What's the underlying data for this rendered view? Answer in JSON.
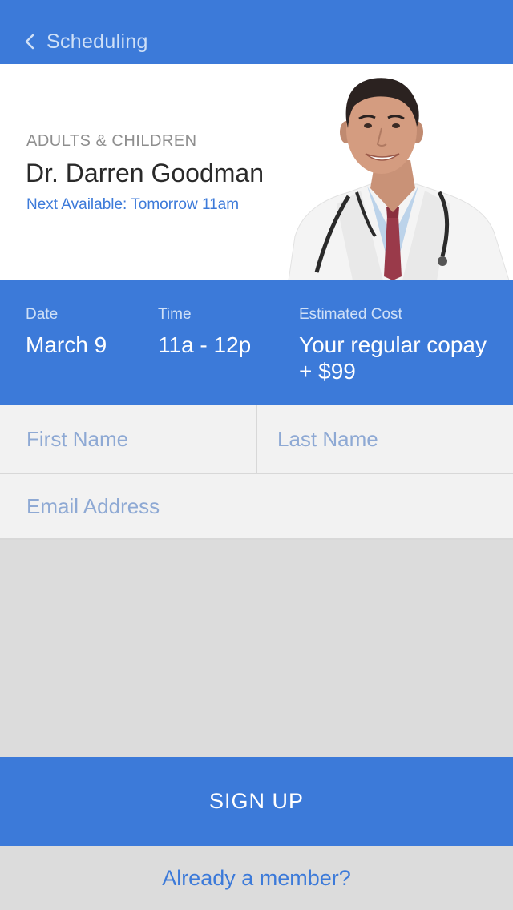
{
  "nav": {
    "back_label": "Scheduling",
    "back_icon": "chevron-left-icon"
  },
  "doctor": {
    "specialty": "ADULTS & CHILDREN",
    "name": "Dr. Darren Goodman",
    "next_available": "Next Available: Tomorrow 11am"
  },
  "appointment": {
    "date_label": "Date",
    "date_value": "March 9",
    "time_label": "Time",
    "time_value": "11a - 12p",
    "cost_label": "Estimated Cost",
    "cost_value_line1": "Your regular copay",
    "cost_value_line2": "+ $99"
  },
  "form": {
    "first_name_placeholder": "First Name",
    "last_name_placeholder": "Last Name",
    "email_placeholder": "Email Address"
  },
  "actions": {
    "signup_label": "SIGN UP",
    "member_label": "Already a member?"
  },
  "colors": {
    "primary": "#3c7ad9",
    "background": "#dcdcdc",
    "form_bg": "#f2f2f2"
  }
}
